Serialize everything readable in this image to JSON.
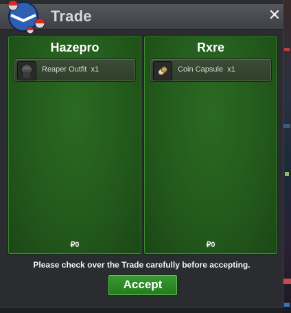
{
  "window": {
    "title": "Trade",
    "close_glyph": "✕"
  },
  "left": {
    "name": "Hazepro",
    "item": {
      "name": "Reaper Outfit",
      "qty": "x1",
      "icon": "reaper-outfit-icon"
    },
    "money": "₽0"
  },
  "right": {
    "name": "Rxre",
    "item": {
      "name": "Coin Capsule",
      "qty": "x1",
      "icon": "coin-capsule-icon"
    },
    "money": "₽0"
  },
  "notice": "Please check over the Trade carefully before accepting.",
  "accept_label": "Accept",
  "colors": {
    "panel_green": "#235a1c",
    "button_green": "#2f8a28",
    "titlebar": "#4a4c51"
  }
}
